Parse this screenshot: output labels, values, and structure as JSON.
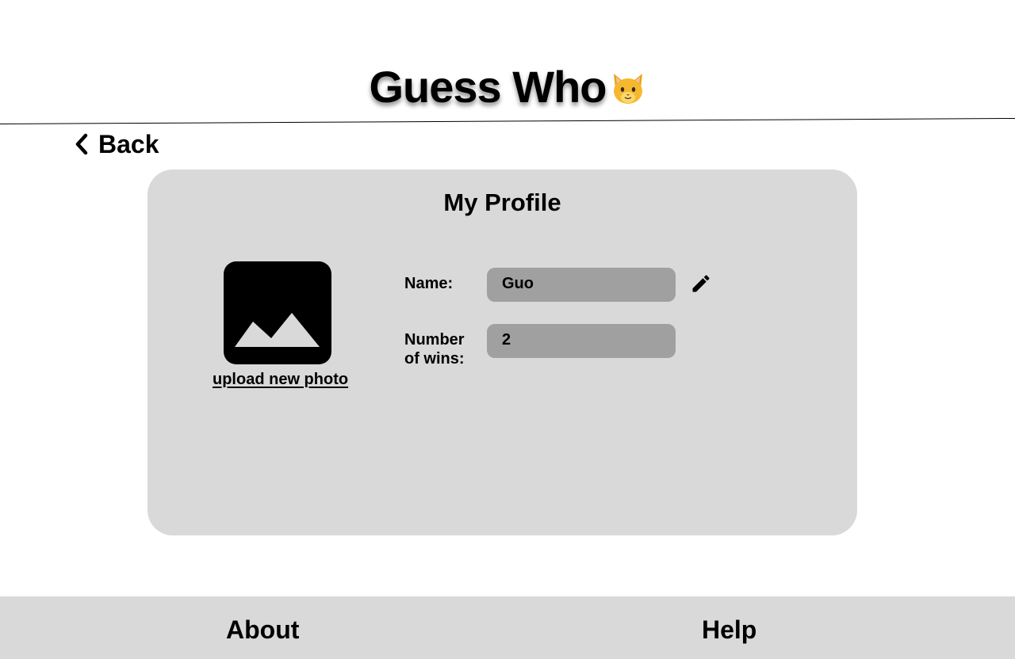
{
  "header": {
    "app_title": "Guess Who",
    "title_emoji": "🐱",
    "title_icon": "cat-face-icon"
  },
  "nav": {
    "back_label": "Back",
    "back_icon": "chevron-left-icon"
  },
  "profile": {
    "title": "My Profile",
    "photo_icon": "image-placeholder-icon",
    "upload_label": "upload new photo",
    "name_label": "Name:",
    "name_value": "Guo",
    "edit_icon": "pencil-icon",
    "wins_label_line1": "Number",
    "wins_label_line2": "of wins:",
    "wins_value": "2"
  },
  "footer": {
    "about_label": "About",
    "help_label": "Help"
  },
  "colors": {
    "card_background": "#d9d9d9",
    "field_background": "#a0a0a0",
    "footer_background": "#d9d9d9",
    "text": "#000000"
  }
}
